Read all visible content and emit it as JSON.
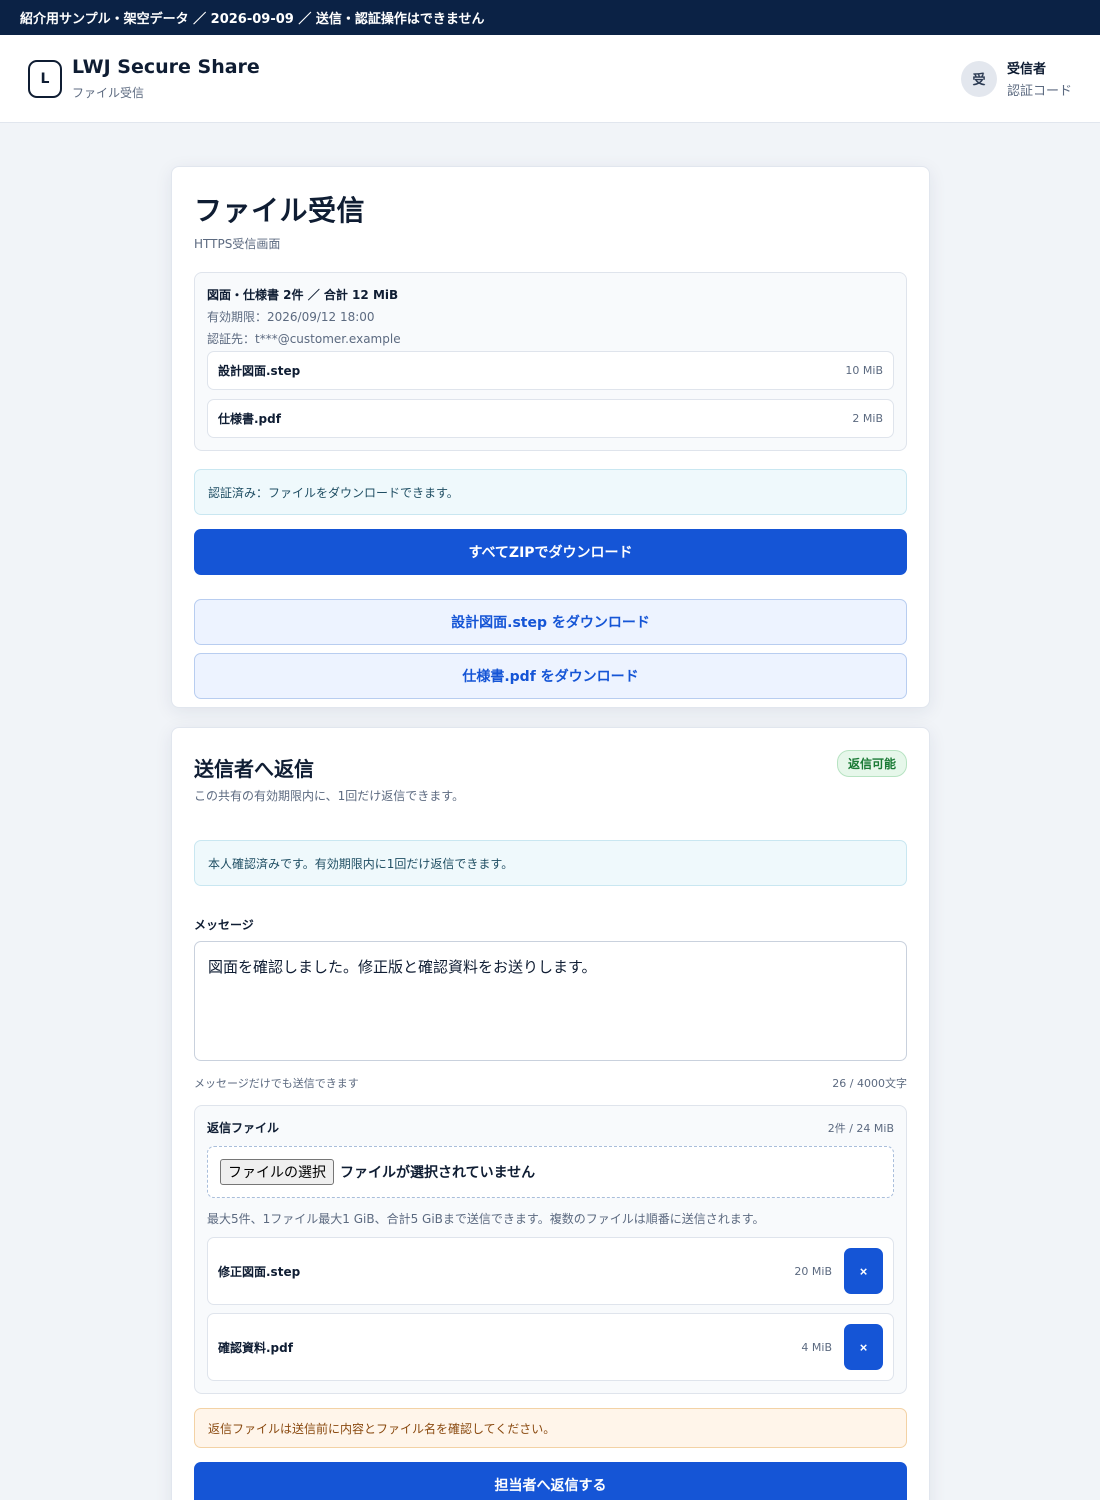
{
  "topbar": {
    "notice": "紹介用サンプル・架空データ ／ 2026-09-09 ／ 送信・認証操作はできません"
  },
  "header": {
    "logo_letter": "L",
    "app_title": "LWJ Secure Share",
    "app_subtitle": "ファイル受信",
    "avatar_letter": "受",
    "user_name": "受信者",
    "user_role": "認証コード"
  },
  "receive": {
    "title": "ファイル受信",
    "subtitle": "HTTPS受信画面",
    "summary": "図面・仕様書 2件 ／ 合計 12 MiB",
    "expiry": "有効期限：2026/09/12 18:00",
    "recipient": "認証先：t***@customer.example",
    "files": [
      {
        "name": "設計図面.step",
        "size": "10 MiB"
      },
      {
        "name": "仕様書.pdf",
        "size": "2 MiB"
      }
    ],
    "auth_notice": "認証済み：ファイルをダウンロードできます。",
    "zip_button": "すべてZIPでダウンロード",
    "download_buttons": [
      "設計図面.step をダウンロード",
      "仕様書.pdf をダウンロード"
    ]
  },
  "reply": {
    "title": "送信者へ返信",
    "subtitle": "この共有の有効期限内に、1回だけ返信できます。",
    "badge": "返信可能",
    "verified_notice": "本人確認済みです。有効期限内に1回だけ返信できます。",
    "message_label": "メッセージ",
    "message_value": "図面を確認しました。修正版と確認資料をお送りします。",
    "message_hint": "メッセージだけでも送信できます",
    "char_count": "26 / 4000文字",
    "files_label": "返信ファイル",
    "files_count": "2件 / 24 MiB",
    "picker_button": "ファイルの選択",
    "picker_status": "ファイルが選択されていません",
    "limit_note": "最大5件、1ファイル最大1 GiB、合計5 GiBまで送信できます。複数のファイルは順番に送信されます。",
    "files": [
      {
        "name": "修正図面.step",
        "size": "20 MiB",
        "remove": "×"
      },
      {
        "name": "確認資料.pdf",
        "size": "4 MiB",
        "remove": "×"
      }
    ],
    "warning": "返信ファイルは送信前に内容とファイル名を確認してください。",
    "submit_button": "担当者へ返信する"
  },
  "colors": {
    "primary": "#1555d6",
    "topbar": "#0b2245",
    "badge_green": "#1a7a35",
    "warning_bg": "#fff5ea"
  }
}
